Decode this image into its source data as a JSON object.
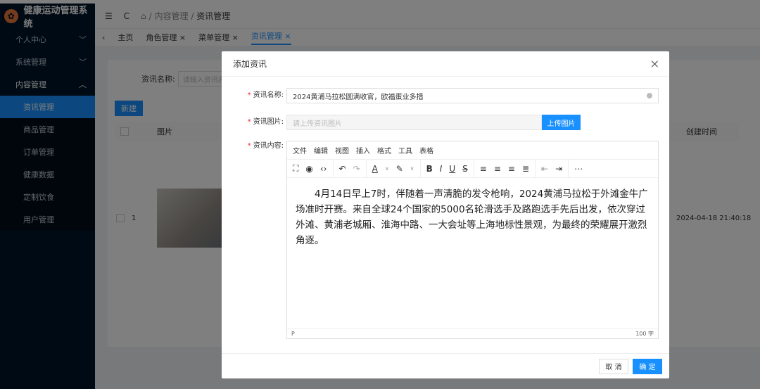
{
  "app": {
    "title": "健康运动管理系统"
  },
  "sidebar": {
    "items": [
      {
        "label": "个人中心",
        "arrow": "﹀"
      },
      {
        "label": "系统管理",
        "arrow": "﹀"
      },
      {
        "label": "内容管理",
        "arrow": "︿"
      }
    ],
    "sub": [
      "资讯管理",
      "商品管理",
      "订单管理",
      "健康数据",
      "定制饮食",
      "用户管理"
    ]
  },
  "header": {
    "breadcrumb": [
      "内容管理",
      "资讯管理"
    ],
    "sep": "/"
  },
  "tabs": [
    "主页",
    "角色管理 ×",
    "菜单管理 ×",
    "资讯管理 ×"
  ],
  "page": {
    "search_label": "资讯名称:",
    "search_placeholder": "请输入资讯名称",
    "new_button": "新建",
    "col_image": "图片",
    "col_created": "创建时间",
    "row_index": "1",
    "row_created": "2024-04-18 21:40:18"
  },
  "modal": {
    "title": "添加资讯",
    "close": "×",
    "name_label": "资讯名称:",
    "name_value": "2024黄浦马拉松圆满收官，欧福蛋业多措",
    "image_label": "资讯图片:",
    "image_placeholder": "请上传资讯图片",
    "upload_button": "上传图片",
    "content_label": "资讯内容:",
    "editor_menu": [
      "文件",
      "编辑",
      "视图",
      "插入",
      "格式",
      "工具",
      "表格"
    ],
    "editor_text": "4月14日早上7时，伴随着一声清脆的发令枪响，2024黄浦马拉松于外滩金牛广场准时开赛。来自全球24个国家的5000名轮滑选手及路跑选手先后出发，依次穿过外滩、黄浦老城厢、淮海中路、一大会址等上海地标性景观，为最终的荣耀展开激烈角逐。",
    "status_path": "P",
    "word_count": "100 字",
    "cancel": "取 消",
    "ok": "确 定"
  }
}
